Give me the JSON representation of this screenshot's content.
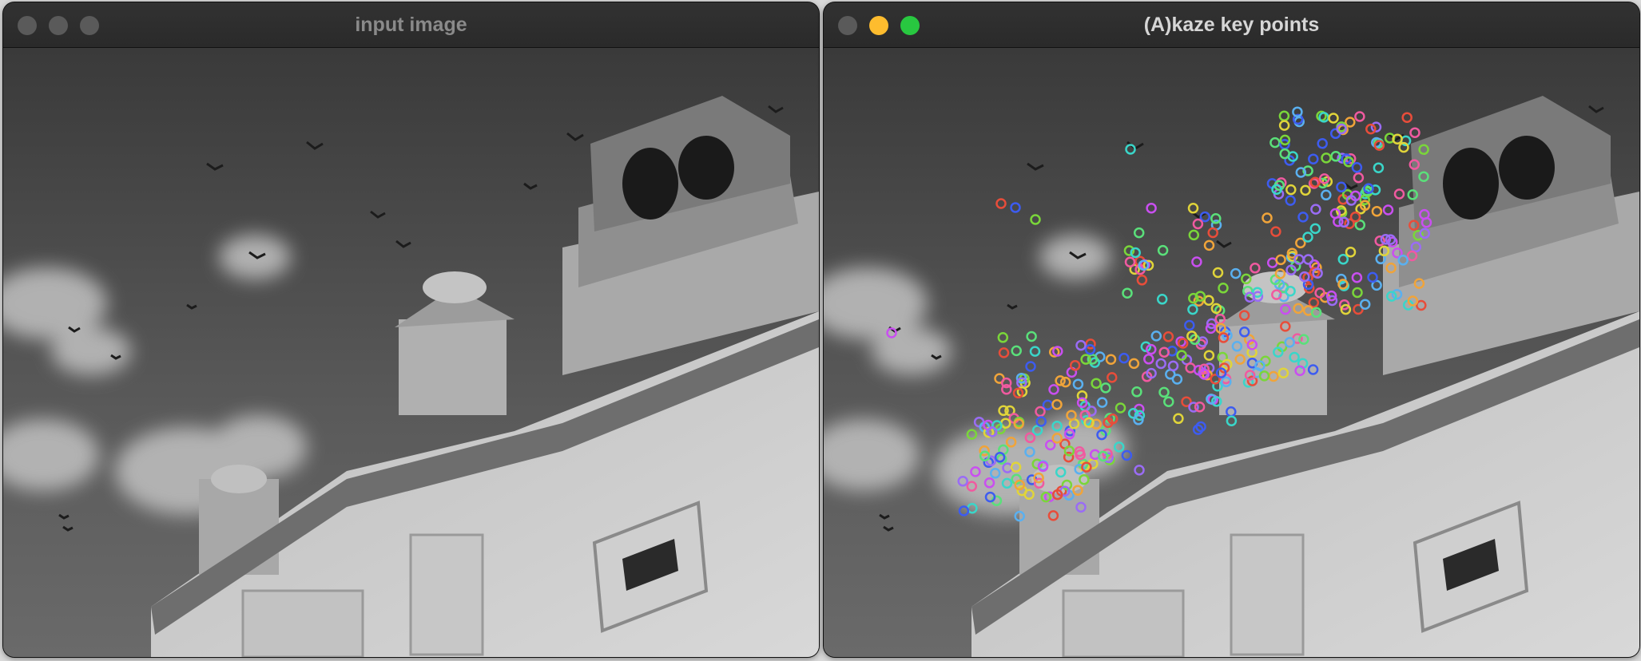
{
  "windows": [
    {
      "title": "input image",
      "state": "inactive",
      "image": "grayscale photograph of an ornate white palace with towers against a cloudy sky with flying birds"
    },
    {
      "title": "(A)kaze key points",
      "state": "active",
      "image": "same grayscale photograph overlaid with many small multicolored keypoint circles on the building",
      "keypoint_colors": [
        "#e84d3a",
        "#3d5cf0",
        "#7ad63a",
        "#c94ff0",
        "#3ad6c9",
        "#f0a43a",
        "#9a6cf5",
        "#f05aa0",
        "#5ae07a",
        "#e0d43a",
        "#5ab0f0"
      ]
    }
  ],
  "traffic_lights": {
    "close": "#ff5f57",
    "minimize": "#febc2e",
    "zoom": "#28c840",
    "inactive": "#5a5a5a"
  }
}
